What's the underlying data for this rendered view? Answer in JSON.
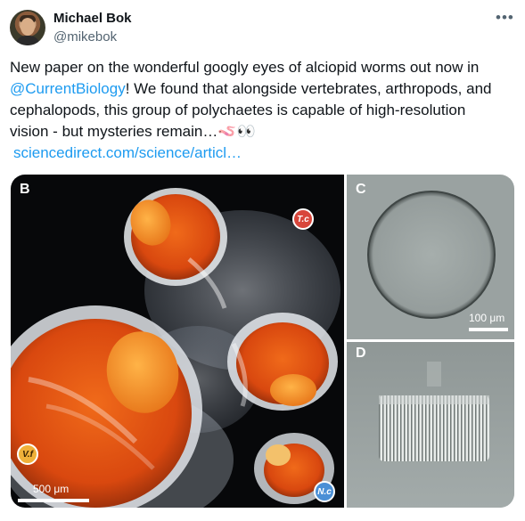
{
  "tweet": {
    "author_name": "Michael Bok",
    "author_handle": "@mikebok",
    "more_icon": "more-horizontal-icon",
    "text_lines": [
      "New paper on the wonderful googly eyes of alciopid worms out now in",
      "! We found that alongside vertebrates, arthropods, and",
      "cephalopods, this group of polychaetes is capable of high-resolution",
      "vision - but mysteries remain…"
    ],
    "mention": "@CurrentBiology",
    "emoji": "🪱👀",
    "link": "sciencedirect.com/science/articl…"
  },
  "media": {
    "panel_b": {
      "label": "B",
      "badge_tc": "T.c",
      "badge_vf": "V.f",
      "badge_nc": "N.c",
      "scale_label": "500 μm"
    },
    "panel_c": {
      "label": "C",
      "scale_label": "100 μm"
    },
    "panel_d": {
      "label": "D"
    },
    "colors": {
      "badge_tc": "#d8463b",
      "badge_vf": "#f0b13a",
      "badge_nc": "#4a8fd6"
    }
  }
}
